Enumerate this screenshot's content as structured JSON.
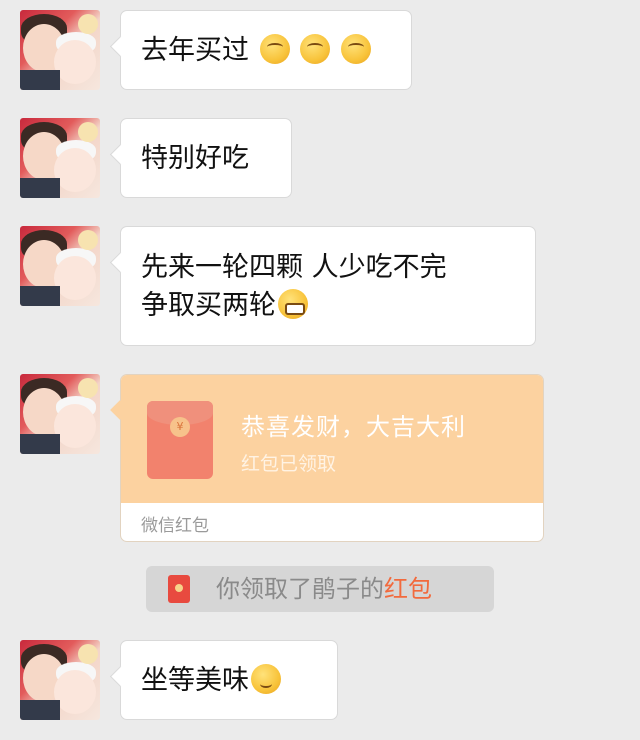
{
  "messages": [
    {
      "text": "去年买过",
      "emojis": [
        "thinking-icon",
        "thinking-icon",
        "thinking-icon"
      ]
    },
    {
      "text": "特别好吃"
    },
    {
      "line1": "先来一轮四颗 人少吃不完",
      "line2": "争取买两轮",
      "emoji": "grin-icon"
    },
    {
      "text": "坐等美味",
      "emoji": "yum-icon"
    }
  ],
  "red_packet": {
    "greeting": "恭喜发财，大吉大利",
    "status": "红包已领取",
    "footer": "微信红包",
    "coin_symbol": "¥"
  },
  "notice": {
    "prefix": "你领取了鹃子的",
    "link": "红包"
  },
  "colors": {
    "background": "#ebebeb",
    "red_packet": "#fcd2a0",
    "link": "#f26a3d"
  }
}
